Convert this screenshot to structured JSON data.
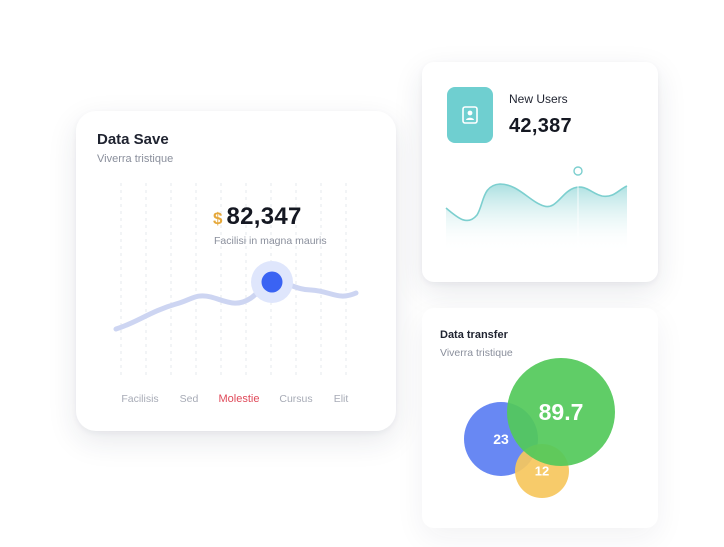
{
  "data_save": {
    "title": "Data Save",
    "subtitle": "Viverra tristique",
    "currency": "$",
    "amount": "82,347",
    "amount_caption": "Facilisi in magna mauris",
    "categories": [
      "Facilisis",
      "Sed",
      "Molestie",
      "Cursus",
      "Elit"
    ],
    "active_category": "Molestie",
    "colors": {
      "line": "#cdd5f2",
      "marker": "#3a63f3",
      "currency": "#e5a83b",
      "active_label": "#e04a5a"
    }
  },
  "new_users": {
    "label": "New Users",
    "value": "42,387",
    "icon": "user-icon",
    "colors": {
      "icon_bg": "#6fcfd0",
      "line": "#7ccfcf"
    }
  },
  "data_transfer": {
    "title": "Data transfer",
    "subtitle": "Viverra tristique",
    "bubbles": [
      {
        "label": "23",
        "color": "#5b7ef2"
      },
      {
        "label": "12",
        "color": "#f6c75d"
      },
      {
        "label": "89.7",
        "color": "#52c95a"
      }
    ]
  }
}
